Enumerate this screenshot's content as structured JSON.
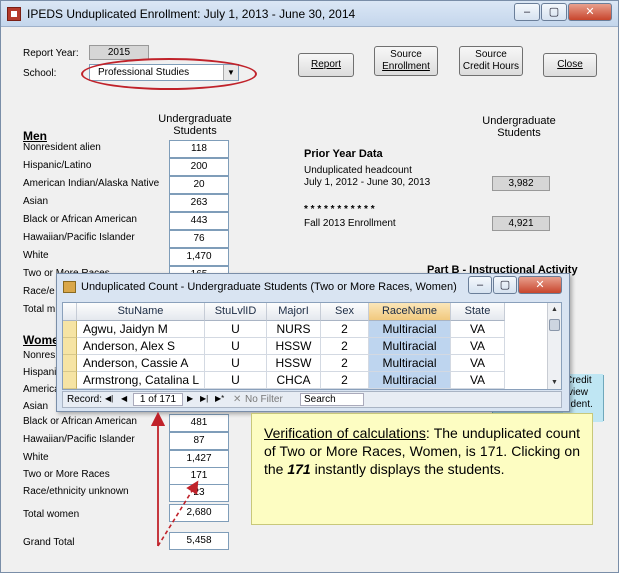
{
  "window": {
    "title": "IPEDS Unduplicated Enrollment:  July 1, 2013 - June 30, 2014",
    "controls": {
      "minimize": "–",
      "maximize": "▢",
      "close": "✕"
    }
  },
  "header": {
    "report_year_label": "Report Year:",
    "report_year_value": "2015",
    "school_label": "School:",
    "school_value": "Professional Studies",
    "buttons": {
      "report": "Report",
      "source_enrollment_1": "Source",
      "source_enrollment_2": "Enrollment",
      "source_credit_1": "Source",
      "source_credit_2": "Credit Hours",
      "close": "Close"
    }
  },
  "left": {
    "col_header_1": "Undergraduate",
    "col_header_2": "Students",
    "men_heading": "Men",
    "men": [
      {
        "label": "Nonresident alien",
        "value": "118"
      },
      {
        "label": "Hispanic/Latino",
        "value": "200"
      },
      {
        "label": "American Indian/Alaska Native",
        "value": "20"
      },
      {
        "label": "Asian",
        "value": "263"
      },
      {
        "label": "Black or African American",
        "value": "443"
      },
      {
        "label": "Hawaiian/Pacific Islander",
        "value": "76"
      },
      {
        "label": "White",
        "value": "1,470"
      },
      {
        "label": "Two or More Races",
        "value": "165"
      },
      {
        "label": "Race/e",
        "value": ""
      },
      {
        "label": "Total m",
        "value": ""
      }
    ],
    "women_heading": "Wome",
    "women_partial": [
      "Nonres",
      "Hispani",
      "America",
      "Asian"
    ],
    "women": [
      {
        "label": "Black or African American",
        "value": "481"
      },
      {
        "label": "Hawaiian/Pacific Islander",
        "value": "87"
      },
      {
        "label": "White",
        "value": "1,427"
      },
      {
        "label": "Two or More Races",
        "value": "171"
      },
      {
        "label": "Race/ethnicity unknown",
        "value": "23"
      }
    ],
    "total_women_label": "Total women",
    "total_women_value": "2,680",
    "grand_total_label": "Grand Total",
    "grand_total_value": "5,458"
  },
  "right": {
    "col_header_1": "Undergraduate",
    "col_header_2": "Students",
    "prior_year_heading": "Prior Year Data",
    "unduplicated_line1": "Unduplicated headcount",
    "unduplicated_line2": "July 1, 2012 - June 30, 2013",
    "unduplicated_value": "3,982",
    "asterisks": "* * * * * * * * * * *",
    "fall_label": "Fall 2013 Enrollment",
    "fall_value": "4,921",
    "part_b": "Part B - Instructional Activity",
    "credit_fragments": [
      "Credit",
      "view",
      "udent."
    ]
  },
  "popup": {
    "title": "Unduplicated Count - Undergraduate Students (Two or More Races, Women)",
    "columns": [
      "StuName",
      "StuLvlID",
      "MajorI",
      "Sex",
      "RaceName",
      "State"
    ],
    "rows": [
      [
        "Agwu, Jaidyn M",
        "U",
        "NURS",
        "2",
        "Multiracial",
        "VA"
      ],
      [
        "Anderson, Alex S",
        "U",
        "HSSW",
        "2",
        "Multiracial",
        "VA"
      ],
      [
        "Anderson, Cassie A",
        "U",
        "HSSW",
        "2",
        "Multiracial",
        "VA"
      ],
      [
        "Armstrong, Catalina L",
        "U",
        "CHCA",
        "2",
        "Multiracial",
        "VA"
      ]
    ],
    "nav": {
      "record_label": "Record:",
      "first": "◀|",
      "prev": "◀",
      "position": "1 of 171",
      "next": "▶",
      "last": "▶|",
      "new": "▶*",
      "filter": "No Filter",
      "search": "Search"
    }
  },
  "callout": {
    "lead": "Verification of calculations",
    "text1": ": The unduplicated count of Two or More Races, Women,  is 171.  Clicking on the ",
    "emph": "171",
    "text2": " instantly displays the students."
  },
  "colors": {
    "annotation_red": "#c0222a",
    "callout_bg": "#fdfdc2",
    "highlight": "#bed5ef"
  }
}
